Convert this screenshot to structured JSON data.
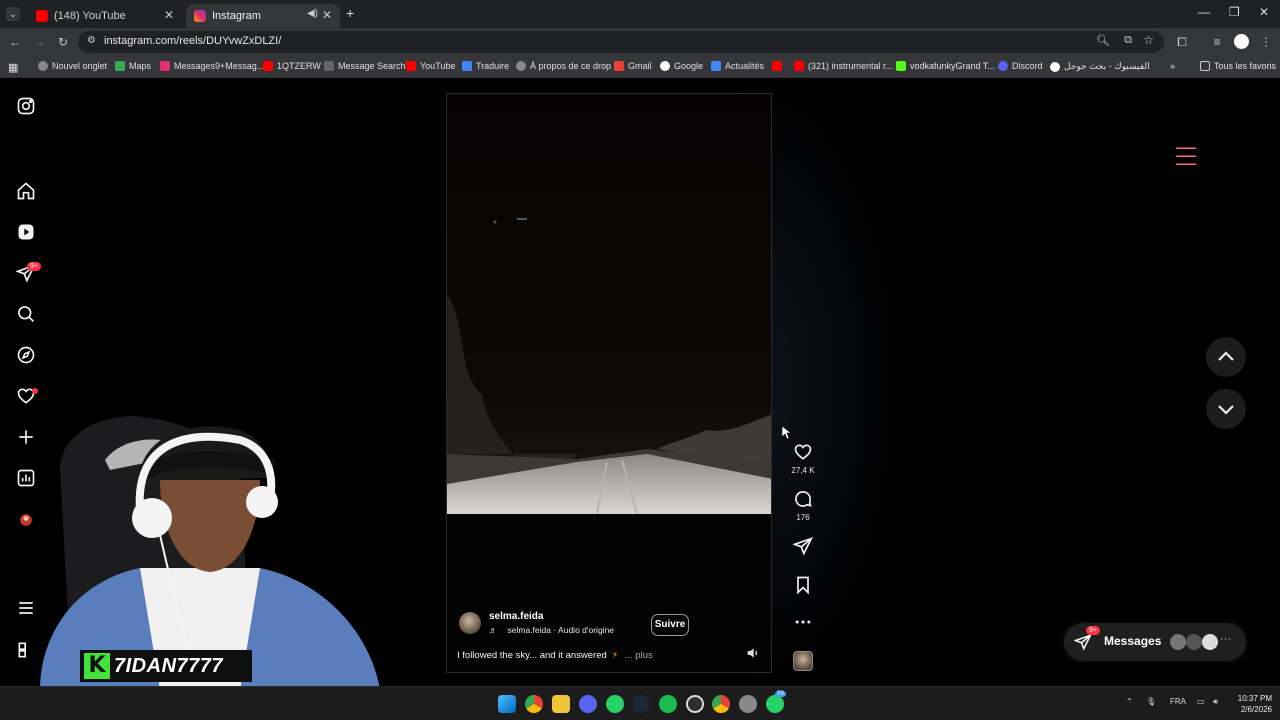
{
  "browser": {
    "tabs": [
      {
        "title": "(148) YouTube",
        "active": false
      },
      {
        "title": "Instagram",
        "active": true
      }
    ],
    "url": "instagram.com/reels/DUYvwZxDLZI/",
    "bookmarks": [
      "Nouvel onglet",
      "Maps",
      "Messages9+Messag...",
      "1QTZERW",
      "Message Search",
      "YouTube",
      "Traduire",
      "À propos de ce drop",
      "Gmail",
      "Google",
      "Actualités",
      "",
      "(321) instrumental r...",
      "vodkafunkyGrand T...",
      "Discord",
      "الفيسبوك - بحث جوجل"
    ],
    "all_favorites": "Tous les favoris"
  },
  "nav": {
    "notif_badge": "9+"
  },
  "reel": {
    "username": "selma.feida",
    "audio": "selma.feida · Audio d'origine",
    "follow_label": "Suivre",
    "caption": "I followed the sky... and it answered",
    "caption_emoji": "⚡",
    "more_label": "... plus"
  },
  "actions": {
    "likes": "27,4 K",
    "comments": "176"
  },
  "messages": {
    "label": "Messages",
    "badge": "9+"
  },
  "streamer": {
    "logo": "K",
    "name": "7IDAN7777"
  },
  "taskbar": {
    "language": "FRA",
    "time": "10:37 PM",
    "date": "2/6/2026",
    "steam_badge": "70"
  },
  "colors": {
    "accent_red": "#ff3040",
    "streamer_green": "#41e33a"
  }
}
